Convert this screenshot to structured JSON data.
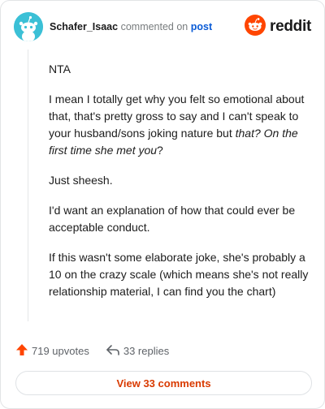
{
  "header": {
    "username": "Schafer_Isaac",
    "verb": "commented on",
    "post_link": "post",
    "logo_text": "reddit"
  },
  "comment": {
    "p1": "NTA",
    "p2_a": "I mean I totally get why you felt so emotional about that, that's pretty gross to say and I can't speak to your husband/sons joking nature but ",
    "p2_italic": "that? On the first time she met you",
    "p2_end": "?",
    "p3": "Just sheesh.",
    "p4": "I'd want an explanation of how that could ever be acceptable conduct.",
    "p5": "If this wasn't some elaborate joke, she's probably a 10 on the crazy scale (which means she's not really relationship material, I can find you the chart)"
  },
  "footer": {
    "upvotes": "719 upvotes",
    "replies": "33 replies",
    "view_button": "View 33 comments"
  },
  "colors": {
    "brand": "#ff4500",
    "upvote": "#ff4500",
    "link": "#0a5bd6",
    "avatar_bg": "#3bc0d6"
  },
  "icons": [
    "snoo-avatar-icon",
    "reddit-logo-icon",
    "upvote-arrow-icon",
    "reply-arrow-icon"
  ]
}
